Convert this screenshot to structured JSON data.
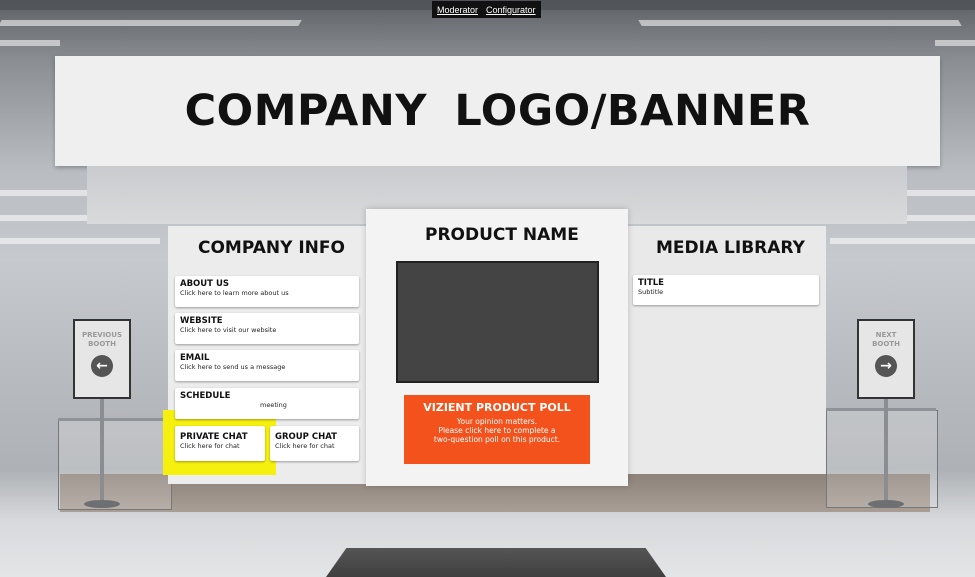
{
  "toolbar": {
    "moderator_label": "Moderator",
    "configurator_label": "Configurator"
  },
  "banner": {
    "text": "COMPANY  LOGO/BANNER"
  },
  "company_info": {
    "title": "COMPANY INFO",
    "items": [
      {
        "title": "ABOUT US",
        "subtitle": "Click here to learn more about us"
      },
      {
        "title": "WEBSITE",
        "subtitle": "Click here to visit our website"
      },
      {
        "title": "EMAIL",
        "subtitle": "Click here to send us a message"
      },
      {
        "title": "SCHEDULE",
        "subtitle": "meeting"
      },
      {
        "title": "PRIVATE CHAT",
        "subtitle": "Click here for chat"
      },
      {
        "title": "GROUP CHAT",
        "subtitle": "Click here for chat"
      }
    ]
  },
  "product": {
    "title": "PRODUCT NAME",
    "poll": {
      "title": "VIZIENT PRODUCT POLL",
      "line1": "Your opinion matters.",
      "line2": "Please click here to complete a",
      "line3": "two-question poll on this product."
    }
  },
  "media_library": {
    "title": "MEDIA LIBRARY",
    "items": [
      {
        "title": "TITLE",
        "subtitle": "Subtitle"
      }
    ]
  },
  "nav": {
    "previous": {
      "line1": "PREVIOUS",
      "line2": "BOOTH",
      "icon": "arrow-left-icon"
    },
    "next": {
      "line1": "NEXT",
      "line2": "BOOTH",
      "icon": "arrow-right-icon"
    }
  },
  "colors": {
    "poll_bg": "#f3521d",
    "highlight": "#f6f00f",
    "screen": "#444444"
  }
}
